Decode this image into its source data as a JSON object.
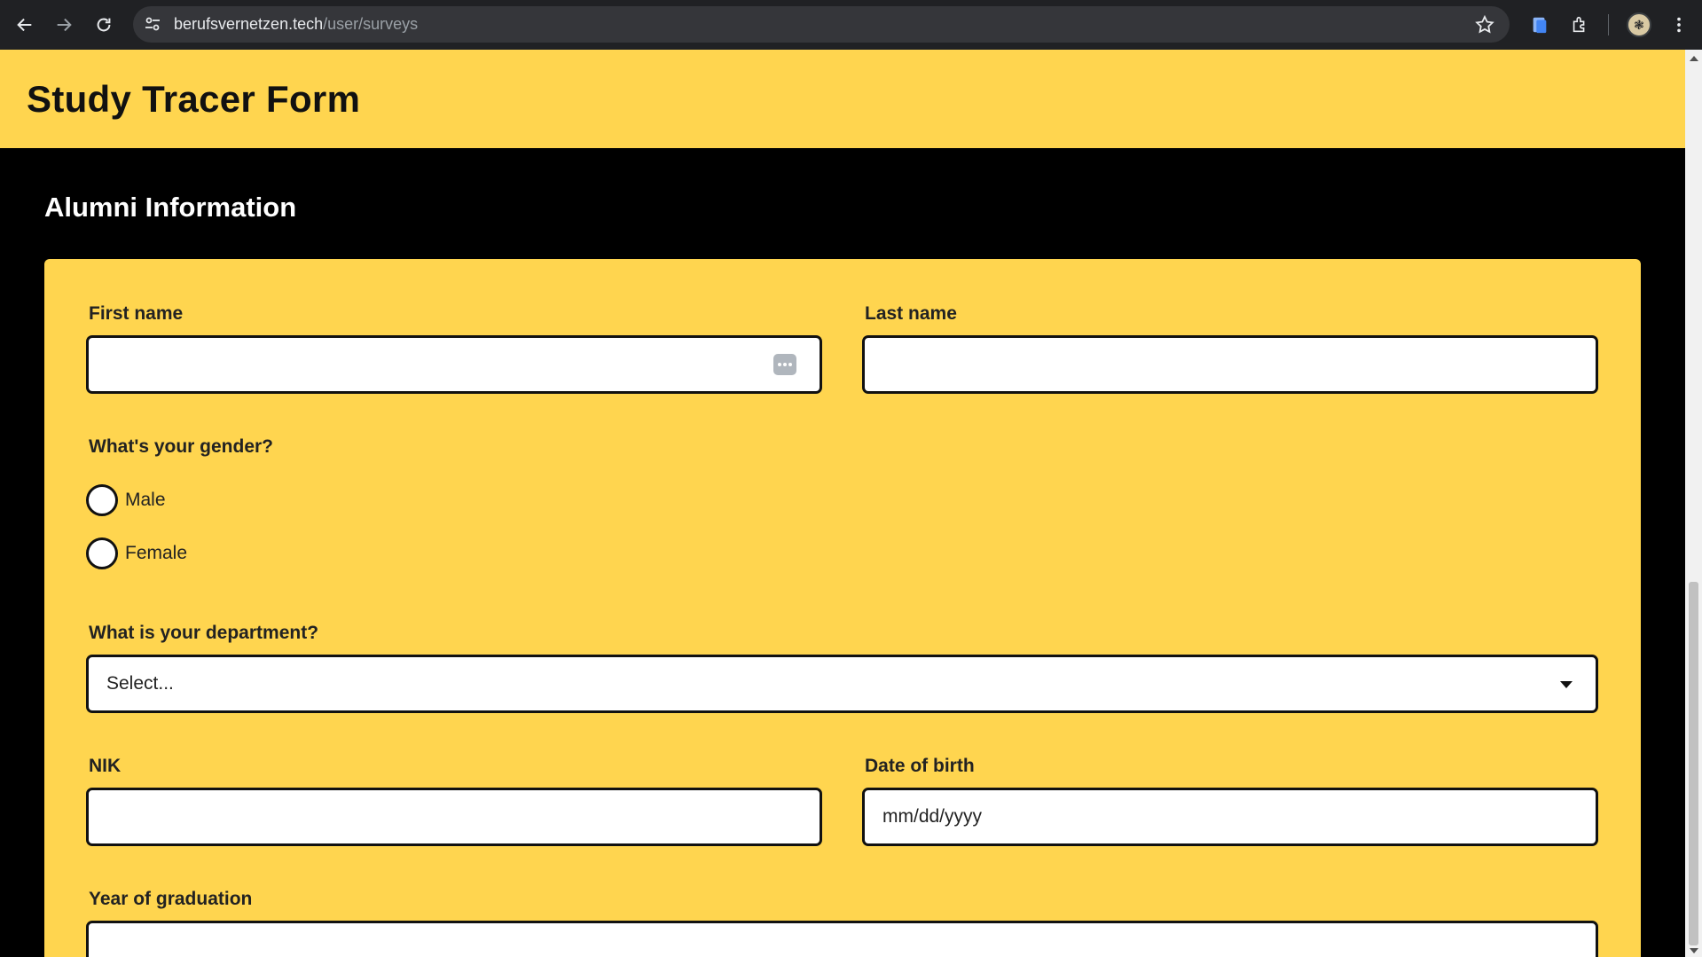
{
  "browser": {
    "url_host": "berufsvernetzen.tech",
    "url_path": "/user/surveys"
  },
  "page": {
    "title": "Study Tracer Form",
    "section_title": "Alumni Information"
  },
  "form": {
    "first_name": {
      "label": "First name",
      "value": ""
    },
    "last_name": {
      "label": "Last name",
      "value": ""
    },
    "gender": {
      "question": "What's your gender?",
      "options": [
        "Male",
        "Female"
      ]
    },
    "department": {
      "label": "What is your department?",
      "placeholder": "Select..."
    },
    "nik": {
      "label": "NIK",
      "value": ""
    },
    "dob": {
      "label": "Date of birth",
      "placeholder": "mm/dd/yyyy"
    },
    "graduation": {
      "label": "Year of graduation",
      "value": ""
    }
  },
  "colors": {
    "accent": "#ffd54f",
    "background": "#000000",
    "chrome": "#202124"
  },
  "icons": [
    "back-icon",
    "forward-icon",
    "reload-icon",
    "site-settings-icon",
    "star-icon",
    "google-docs-icon",
    "extensions-icon",
    "profile-avatar",
    "kebab-menu-icon",
    "autofill-icon",
    "chevron-down-icon"
  ]
}
